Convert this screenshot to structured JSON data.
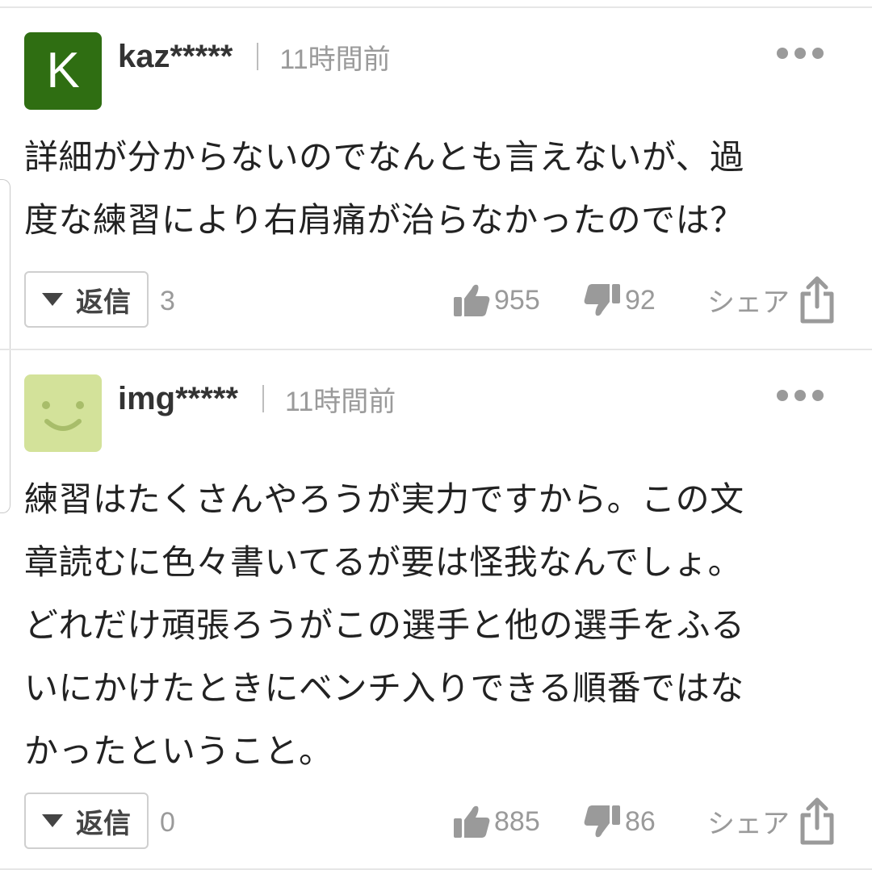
{
  "colors": {
    "avatar1_bg": "#2f6e12",
    "avatar2_bg": "#d3e29a",
    "meta_gray": "#9a9a9a"
  },
  "comments": [
    {
      "avatar_letter": "K",
      "avatar_icon": "letter-avatar-icon",
      "username": "kaz*****",
      "time": "11時間前",
      "body_lines": [
        "詳細が分からないのでなんとも言えないが、過",
        "度な練習により右肩痛が治らなかったのでは？"
      ],
      "reply_label": "返信",
      "reply_count": "3",
      "likes": "955",
      "dislikes": "92",
      "share_label": "シェア"
    },
    {
      "avatar_icon": "smiley-avatar-icon",
      "username": "img*****",
      "time": "11時間前",
      "body_lines": [
        "練習はたくさんやろうが実力ですから。この文",
        "章読むに色々書いてるが要は怪我なんでしょ。",
        "どれだけ頑張ろうがこの選手と他の選手をふる",
        "いにかけたときにベンチ入りできる順番ではな",
        "かったということ。"
      ],
      "reply_label": "返信",
      "reply_count": "0",
      "likes": "885",
      "dislikes": "86",
      "share_label": "シェア"
    }
  ]
}
